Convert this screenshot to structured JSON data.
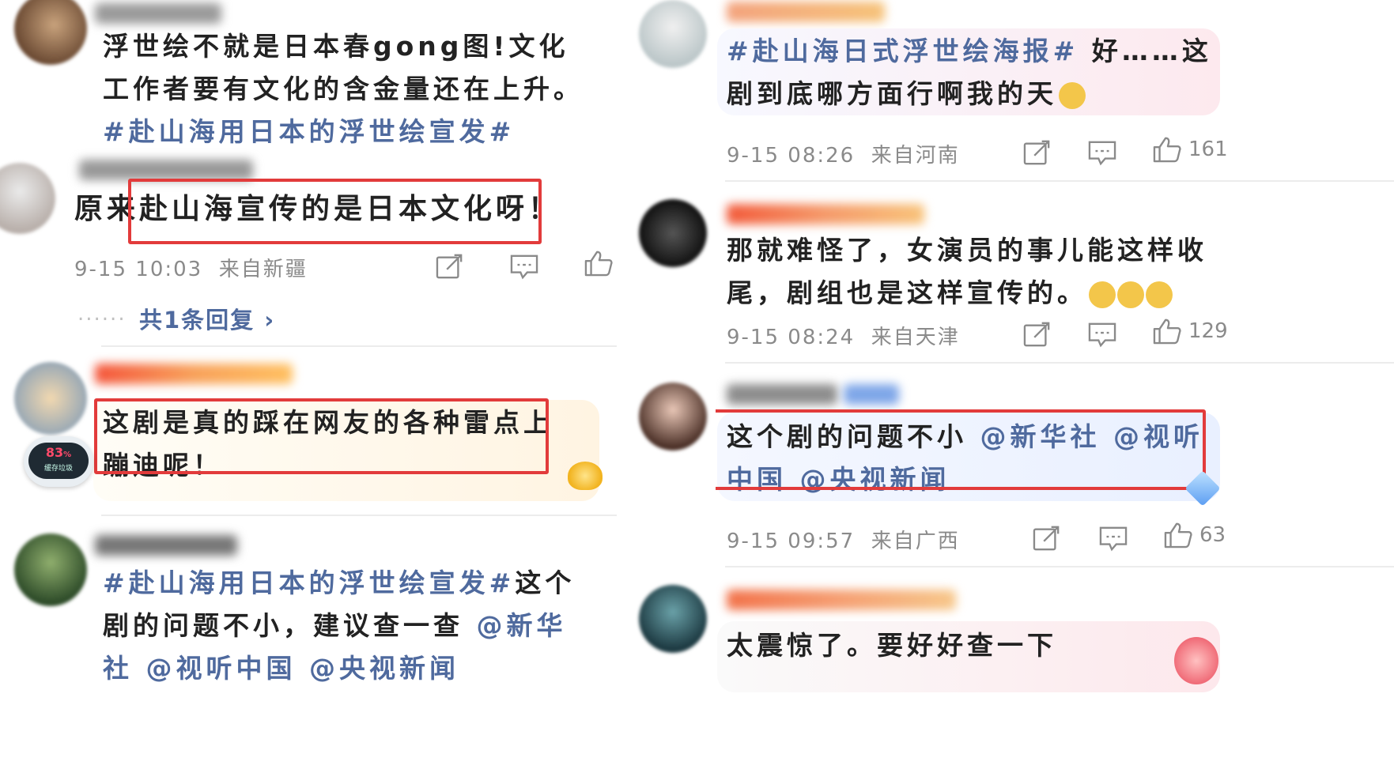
{
  "left": {
    "c1": {
      "text": "浮世绘不就是日本春gong图!文化工作者要有文化的含金量还在上升。",
      "tag": "#赴山海用日本的浮世绘宣发#"
    },
    "c2": {
      "text": "原来赴山海宣传的是日本文化呀！",
      "time": "9-15 10:03",
      "location": "来自新疆",
      "replies": "共1条回复 ›",
      "dots": "......"
    },
    "c3": {
      "text": "这剧是真的踩在网友的各种雷点上蹦迪呢！",
      "badge_value": "83",
      "badge_unit": "%",
      "badge_label": "缓存垃圾"
    },
    "c4": {
      "tag": "#赴山海用日本的浮世绘宣发#",
      "text": "这个剧的问题不小，建议查一查",
      "mentions": "@新华社 @视听中国 @央视新闻"
    }
  },
  "right": {
    "c1": {
      "tag": "#赴山海日式浮世绘海报#",
      "text": "好……这剧到底哪方面行啊我的天",
      "time": "9-15 08:26",
      "location": "来自河南",
      "likes": "161"
    },
    "c2": {
      "text": "那就难怪了，女演员的事儿能这样收尾，剧组也是这样宣传的。",
      "time": "9-15 08:24",
      "location": "来自天津",
      "likes": "129"
    },
    "c3": {
      "text": "这个剧的问题不小",
      "mentions": "@新华社 @视听中国 @央视新闻",
      "time": "9-15 09:57",
      "location": "来自广西",
      "likes": "63"
    },
    "c4": {
      "text": "太震惊了。要好好查一下"
    }
  },
  "colors": {
    "accent_red": "#e23b3b",
    "link_blue": "#4f6a9e",
    "meta_gray": "#8a8a8a"
  },
  "icons": [
    "share-icon",
    "comment-icon",
    "like-icon"
  ]
}
